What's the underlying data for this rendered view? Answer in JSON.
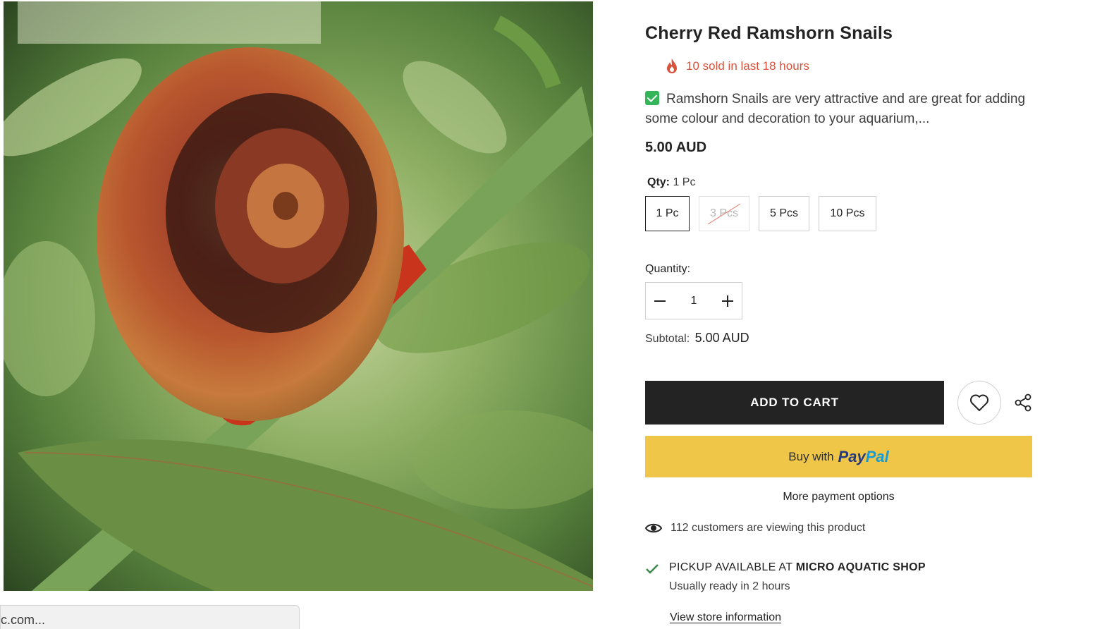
{
  "product": {
    "title": "Cherry Red Ramshorn Snails",
    "sold_text": "10 sold in last 18 hours",
    "description": "Ramshorn Snails are very attractive and are great for adding some colour and decoration to your aquarium,...",
    "price": "5.00 AUD",
    "image_alt": "Cherry red ramshorn snail on aquarium plant"
  },
  "variant": {
    "label": "Qty:",
    "selected": "1 Pc",
    "options": [
      {
        "label": "1 Pc",
        "state": "selected"
      },
      {
        "label": "3 Pcs",
        "state": "sold-out"
      },
      {
        "label": "5 Pcs",
        "state": "available"
      },
      {
        "label": "10 Pcs",
        "state": "available"
      }
    ]
  },
  "quantity": {
    "label": "Quantity:",
    "value": "1"
  },
  "subtotal": {
    "label": "Subtotal:",
    "value": "5.00 AUD"
  },
  "actions": {
    "add_to_cart": "ADD TO CART",
    "paypal_prefix": "Buy with",
    "paypal_brand_1": "Pay",
    "paypal_brand_2": "Pal",
    "more_payment": "More payment options"
  },
  "viewers": {
    "text": "112 customers are viewing this product"
  },
  "pickup": {
    "prefix": "PICKUP AVAILABLE AT",
    "store": "MICRO AQUATIC SHOP",
    "ready": "Usually ready in 2 hours",
    "link": "View store information"
  },
  "status_bar": {
    "text": "c.com..."
  },
  "colors": {
    "sold_accent": "#d8533c",
    "check_green": "#34b55a",
    "cart_button": "#232323",
    "paypal_yellow": "#f0c649",
    "pickup_check": "#3a8a4a"
  }
}
